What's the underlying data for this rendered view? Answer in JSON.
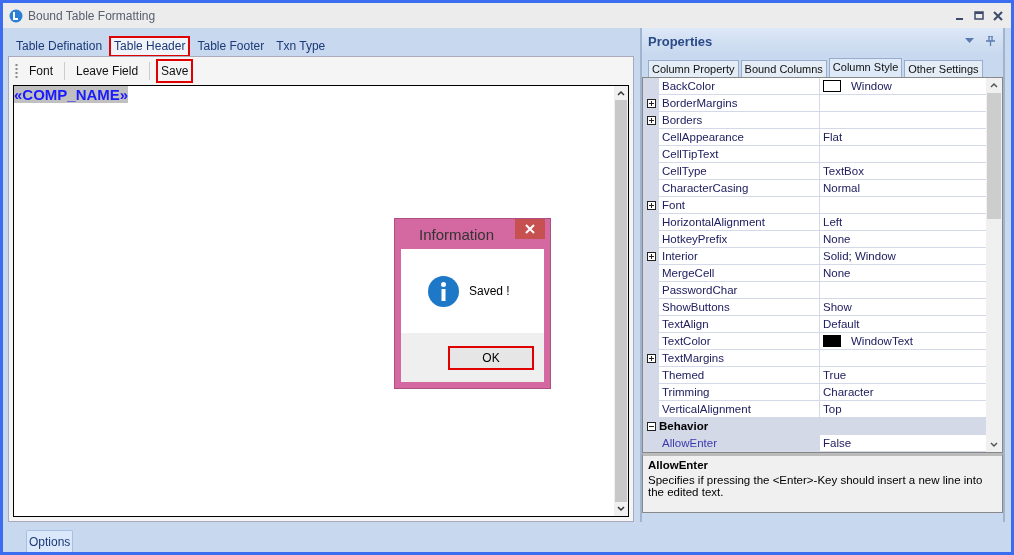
{
  "window": {
    "title": "Bound Table Formatting"
  },
  "tabs": [
    {
      "label": "Table Defination",
      "selected": false,
      "highlighted": false
    },
    {
      "label": "Table Header",
      "selected": true,
      "highlighted": true
    },
    {
      "label": "Table Footer",
      "selected": false,
      "highlighted": false
    },
    {
      "label": "Txn Type",
      "selected": false,
      "highlighted": false
    }
  ],
  "toolbar": [
    {
      "label": "Font",
      "highlighted": false
    },
    {
      "label": "Leave Field",
      "highlighted": false
    },
    {
      "label": "Save",
      "highlighted": true
    }
  ],
  "editor": {
    "field_text": "«COMP_NAME»"
  },
  "dialog": {
    "title": "Information",
    "message": "Saved !",
    "button": {
      "label": "OK",
      "highlighted": true
    }
  },
  "bottom_tabs": [
    {
      "label": "Options",
      "selected": true
    }
  ],
  "properties": {
    "title": "Properties",
    "tabs": [
      {
        "label": "Column Property",
        "selected": false
      },
      {
        "label": "Bound Columns",
        "selected": false
      },
      {
        "label": "Column Style",
        "selected": true
      },
      {
        "label": "Other Settings",
        "selected": false
      }
    ],
    "rows": [
      {
        "kind": "property",
        "name": "BackColor",
        "value": "Window",
        "color": "#ffffff",
        "expandable": false,
        "selected": false
      },
      {
        "kind": "property",
        "name": "BorderMargins",
        "expandable": true,
        "selected": false
      },
      {
        "kind": "property",
        "name": "Borders",
        "expandable": true,
        "selected": false
      },
      {
        "kind": "property",
        "name": "CellAppearance",
        "value": "Flat",
        "expandable": false,
        "selected": false
      },
      {
        "kind": "property",
        "name": "CellTipText",
        "expandable": false,
        "selected": false
      },
      {
        "kind": "property",
        "name": "CellType",
        "value": "TextBox",
        "expandable": false,
        "selected": false
      },
      {
        "kind": "property",
        "name": "CharacterCasing",
        "value": "Normal",
        "expandable": false,
        "selected": false
      },
      {
        "kind": "property",
        "name": "Font",
        "expandable": true,
        "selected": false
      },
      {
        "kind": "property",
        "name": "HorizontalAlignment",
        "value": "Left",
        "expandable": false,
        "selected": false
      },
      {
        "kind": "property",
        "name": "HotkeyPrefix",
        "value": "None",
        "expandable": false,
        "selected": false
      },
      {
        "kind": "property",
        "name": "Interior",
        "value": "Solid; Window",
        "expandable": true,
        "selected": false
      },
      {
        "kind": "property",
        "name": "MergeCell",
        "value": "None",
        "expandable": false,
        "selected": false
      },
      {
        "kind": "property",
        "name": "PasswordChar",
        "expandable": false,
        "selected": false
      },
      {
        "kind": "property",
        "name": "ShowButtons",
        "value": "Show",
        "expandable": false,
        "selected": false
      },
      {
        "kind": "property",
        "name": "TextAlign",
        "value": "Default",
        "expandable": false,
        "selected": false
      },
      {
        "kind": "property",
        "name": "TextColor",
        "value": "WindowText",
        "color": "#000000",
        "expandable": false,
        "selected": false
      },
      {
        "kind": "property",
        "name": "TextMargins",
        "expandable": true,
        "selected": false
      },
      {
        "kind": "property",
        "name": "Themed",
        "value": "True",
        "expandable": false,
        "selected": false
      },
      {
        "kind": "property",
        "name": "Trimming",
        "value": "Character",
        "expandable": false,
        "selected": false
      },
      {
        "kind": "property",
        "name": "VerticalAlignment",
        "value": "Top",
        "expandable": false,
        "selected": false
      },
      {
        "kind": "category",
        "name": "Behavior",
        "expanded": true
      },
      {
        "kind": "property",
        "name": "AllowEnter",
        "value": "False",
        "expandable": false,
        "selected": true
      }
    ],
    "description": {
      "title": "AllowEnter",
      "text": "Specifies if pressing the <Enter>-Key should insert a new line into the edited text."
    }
  }
}
